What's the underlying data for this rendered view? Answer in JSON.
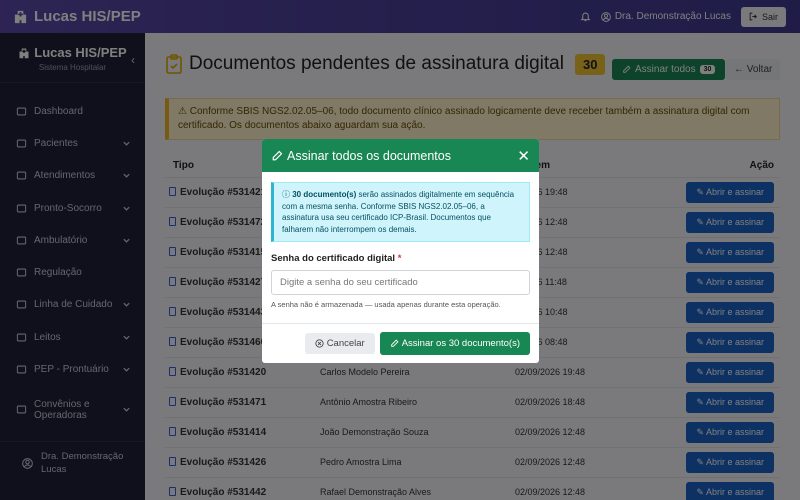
{
  "topbar": {
    "brand": "Lucas HIS/PEP",
    "user": "Dra. Demonstração Lucas",
    "logout_label": "Sair"
  },
  "sidebar": {
    "title": "Lucas HIS/PEP",
    "subtitle": "Sistema Hospitalar",
    "items": [
      {
        "label": "Dashboard",
        "icon": "home-icon",
        "chevron": false
      },
      {
        "label": "Pacientes",
        "icon": "users-icon",
        "chevron": true
      },
      {
        "label": "Atendimentos",
        "icon": "calendar-icon",
        "chevron": true
      },
      {
        "label": "Pronto-Socorro",
        "icon": "ambulance-icon",
        "chevron": true
      },
      {
        "label": "Ambulatório",
        "icon": "calendar-check-icon",
        "chevron": true
      },
      {
        "label": "Regulação",
        "icon": "arrows-icon",
        "chevron": false
      },
      {
        "label": "Linha de Cuidado",
        "icon": "route-icon",
        "chevron": true
      },
      {
        "label": "Leitos",
        "icon": "hospital-icon",
        "chevron": true
      },
      {
        "label": "PEP - Prontuário",
        "icon": "folder-icon",
        "chevron": true
      },
      {
        "label": "Convênios e Operadoras",
        "icon": "building-icon",
        "chevron": true
      }
    ],
    "user": "Dra. Demonstração Lucas"
  },
  "main": {
    "title": "Documentos pendentes de assinatura digital",
    "count": "30",
    "sign_all_label": "Assinar todos",
    "sign_all_count": "30",
    "back_label": "Voltar",
    "alert": "Conforme SBIS NGS2.02.05–06, todo documento clínico assinado logicamente deve receber também a assinatura digital com certificado. Os documentos abaixo aguardam sua ação."
  },
  "table": {
    "headers": {
      "tipo": "Tipo",
      "criado": "ado em",
      "acao": "Ação"
    },
    "open_label": "Abrir e assinar",
    "rows": [
      {
        "tipo": "Evolução #531421",
        "paciente": "",
        "data": "0/2026 19:48"
      },
      {
        "tipo": "Evolução #531472",
        "paciente": "",
        "data": "0/2026 12:48"
      },
      {
        "tipo": "Evolução #531415",
        "paciente": "",
        "data": "0/2026 12:48"
      },
      {
        "tipo": "Evolução #531427",
        "paciente": "",
        "data": "0/2026 11:48"
      },
      {
        "tipo": "Evolução #531443",
        "paciente": "",
        "data": "0/2026 10:48"
      },
      {
        "tipo": "Evolução #531460",
        "paciente": "",
        "data": "0/2026 08:48"
      },
      {
        "tipo": "Evolução #531420",
        "paciente": "Carlos Modelo Pereira",
        "data": "02/09/2026 19:48"
      },
      {
        "tipo": "Evolução #531471",
        "paciente": "Antônio Amostra Ribeiro",
        "data": "02/09/2026 18:48"
      },
      {
        "tipo": "Evolução #531414",
        "paciente": "João Demonstração Souza",
        "data": "02/09/2026 12:48"
      },
      {
        "tipo": "Evolução #531426",
        "paciente": "Pedro Amostra Lima",
        "data": "02/09/2026 12:48"
      },
      {
        "tipo": "Evolução #531442",
        "paciente": "Rafael Demonstração Alves",
        "data": "02/09/2026 12:48"
      }
    ]
  },
  "modal": {
    "title": "Assinar todos os documentos",
    "info_bold": "30 documento(s)",
    "info_rest": " serão assinados digitalmente em sequência com a mesma senha. Conforme SBIS NGS2.02.05–06, a assinatura usa seu certificado ICP-Brasil. Documentos que falharem não interrompem os demais.",
    "field_label": "Senha do certificado digital",
    "required_mark": "*",
    "placeholder": "Digite a senha do seu certificado",
    "hint": "A senha não é armazenada — usada apenas durante esta operação.",
    "cancel_label": "Cancelar",
    "confirm_label": "Assinar os 30 documento(s)"
  }
}
